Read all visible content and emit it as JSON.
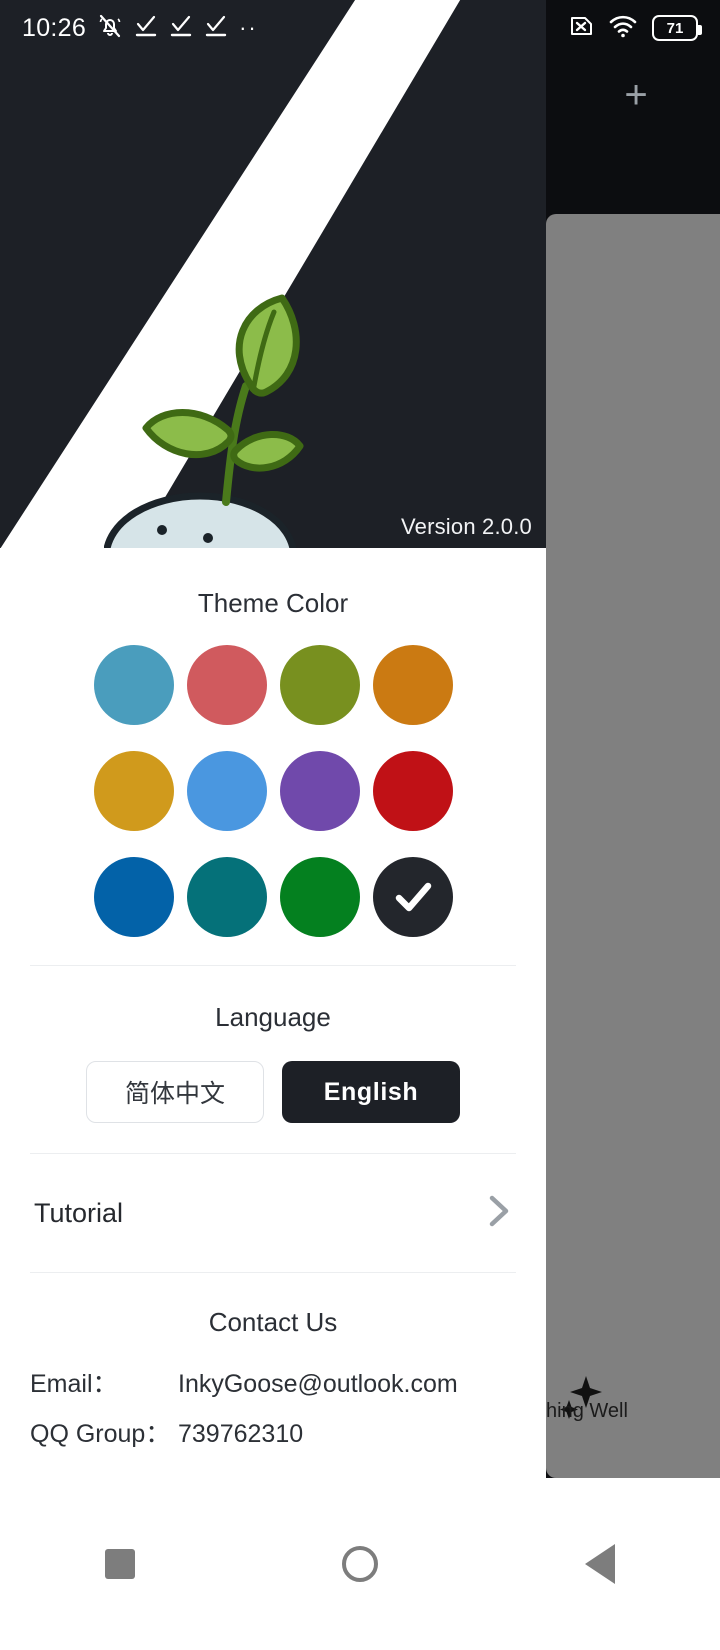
{
  "status_bar": {
    "time": "10:26",
    "overflow": "··",
    "battery_level": "71",
    "icons": [
      "bell-muted-icon",
      "task-check-icon",
      "task-check-icon",
      "task-check-icon",
      "overflow-dots-icon",
      "sim-missing-icon",
      "wifi-icon",
      "battery-icon"
    ]
  },
  "splash": {
    "version": "Version 2.0.0",
    "illustration": "plant-sprout-icon",
    "band_color": "#ffffff",
    "background_color": "#1d2026"
  },
  "background_window": {
    "add_label": "+",
    "card_title": "hing Well",
    "card_icon": "sparkle-icon"
  },
  "theme": {
    "title": "Theme Color",
    "selected_index": 11,
    "swatches": [
      {
        "name": "steel-blue",
        "color": "#4a9dbd"
      },
      {
        "name": "coral-red",
        "color": "#d05a5e"
      },
      {
        "name": "olive-green",
        "color": "#78901f"
      },
      {
        "name": "orange",
        "color": "#cb7a12"
      },
      {
        "name": "amber",
        "color": "#d09a1c"
      },
      {
        "name": "sky-blue",
        "color": "#4a97e0"
      },
      {
        "name": "purple",
        "color": "#7049ab"
      },
      {
        "name": "crimson",
        "color": "#c01116"
      },
      {
        "name": "deep-blue",
        "color": "#0362a8"
      },
      {
        "name": "teal",
        "color": "#057179"
      },
      {
        "name": "green",
        "color": "#04801f"
      },
      {
        "name": "dark-charcoal",
        "color": "#23262c"
      }
    ]
  },
  "language": {
    "title": "Language",
    "options": [
      {
        "label": "简体中文",
        "selected": false
      },
      {
        "label": "English",
        "selected": true
      }
    ]
  },
  "tutorial": {
    "label": "Tutorial",
    "chevron": "chevron-right-icon"
  },
  "contact": {
    "title": "Contact Us",
    "rows": [
      {
        "key": "Email：",
        "value": "InkyGoose@outlook.com"
      },
      {
        "key": "QQ Group：",
        "value": "739762310"
      }
    ]
  },
  "navbar": {
    "recents_label": "recents-square-icon",
    "home_label": "home-circle-icon",
    "back_label": "back-triangle-icon"
  }
}
